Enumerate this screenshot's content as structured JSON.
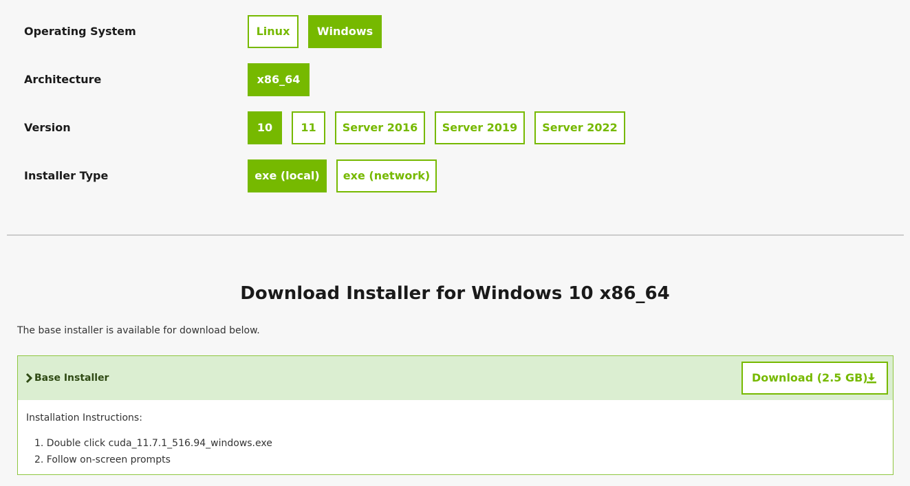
{
  "selectors": [
    {
      "label": "Operating System",
      "options": [
        {
          "label": "Linux",
          "selected": false
        },
        {
          "label": "Windows",
          "selected": true
        }
      ]
    },
    {
      "label": "Architecture",
      "options": [
        {
          "label": "x86_64",
          "selected": true
        }
      ]
    },
    {
      "label": "Version",
      "options": [
        {
          "label": "10",
          "selected": true
        },
        {
          "label": "11",
          "selected": false
        },
        {
          "label": "Server 2016",
          "selected": false
        },
        {
          "label": "Server 2019",
          "selected": false
        },
        {
          "label": "Server 2022",
          "selected": false
        }
      ]
    },
    {
      "label": "Installer Type",
      "options": [
        {
          "label": "exe (local)",
          "selected": true
        },
        {
          "label": "exe (network)",
          "selected": false
        }
      ]
    }
  ],
  "download": {
    "title": "Download Installer for Windows 10 x86_64",
    "description": "The base installer is available for download below.",
    "panel": {
      "title": "Base Installer",
      "button_label": "Download (2.5 GB)",
      "expand_icon": "chevron-right-icon",
      "download_icon": "download-icon",
      "instructions_title": "Installation Instructions:",
      "steps": [
        "1. Double click cuda_11.7.1_516.94_windows.exe",
        "2. Follow on-screen prompts"
      ]
    }
  },
  "colors": {
    "accent": "#76b900",
    "panel_header_bg": "#dbeed1",
    "panel_border": "#8ec63f",
    "page_bg": "#f7f7f7"
  }
}
